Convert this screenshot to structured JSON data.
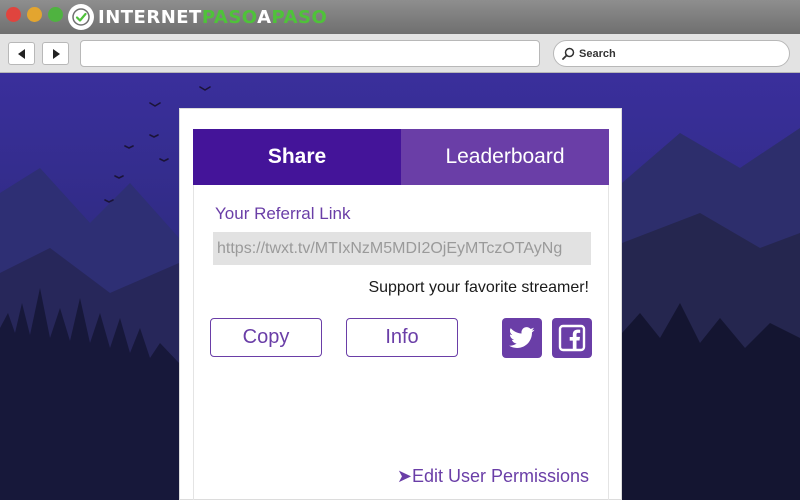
{
  "browser": {
    "logo": {
      "part1": "INTERNET",
      "part2": "PASO",
      "part3": "A",
      "part4": "PASO"
    },
    "search_placeholder": "Search",
    "back_icon": "back-arrow-icon",
    "forward_icon": "forward-arrow-icon"
  },
  "panel": {
    "tabs": [
      {
        "label": "Share",
        "active": true
      },
      {
        "label": "Leaderboard",
        "active": false
      }
    ],
    "referral_title": "Your Referral Link",
    "referral_link": "https://twxt.tv/MTIxNzM5MDI2OjEyMTczOTAyNg",
    "support_text": "Support your favorite streamer!",
    "buttons": {
      "copy": "Copy",
      "info": "Info"
    },
    "social": [
      {
        "icon": "twitter-icon"
      },
      {
        "icon": "facebook-icon"
      }
    ],
    "edit_permissions": "➤Edit User Permissions"
  },
  "colors": {
    "brand_purple": "#6a3ea7",
    "active_tab": "#441499",
    "logo_green": "#4fc23a",
    "sky": "#2e2a86"
  }
}
